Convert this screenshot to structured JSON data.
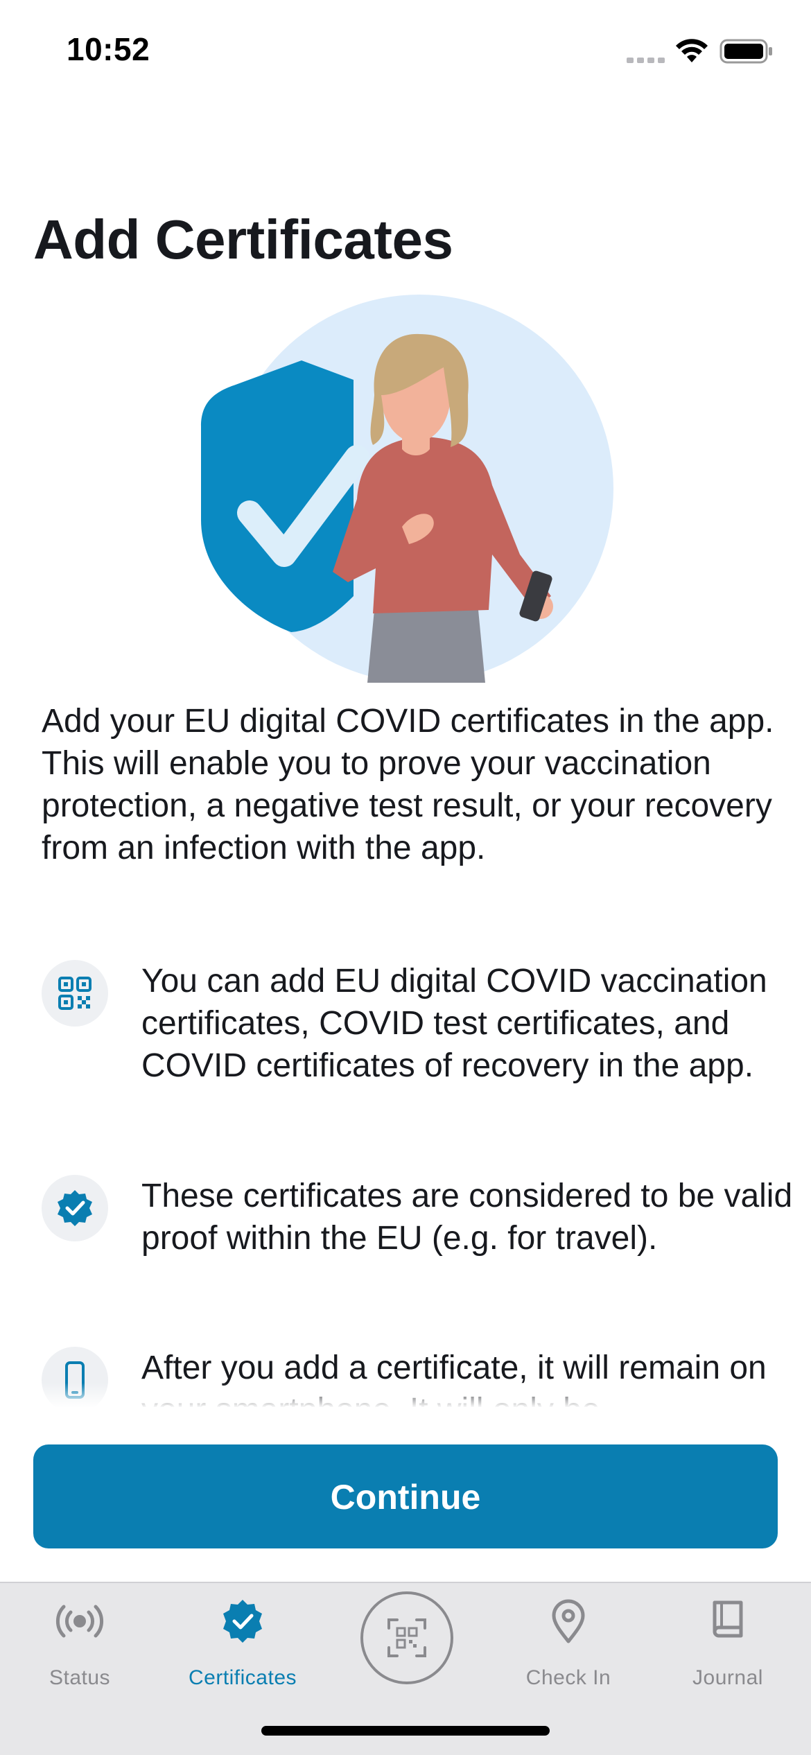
{
  "status_bar": {
    "time": "10:52"
  },
  "page": {
    "title": "Add Certificates",
    "intro": "Add your EU digital COVID certificates in the app. This will enable you to prove your vaccination protection, a negative test result, or your recovery from an infection with the app."
  },
  "features": [
    {
      "icon": "qr-code-icon",
      "text": "You can add EU digital COVID vaccination certificates, COVID test certificates, and COVID certificates of recovery in the app."
    },
    {
      "icon": "verified-badge-icon",
      "text": "These certificates are considered to be valid proof within the EU (e.g. for travel)."
    },
    {
      "icon": "smartphone-icon",
      "text": "After you add a certificate, it will remain on your smartphone. It will only be"
    }
  ],
  "continue_button": {
    "label": "Continue"
  },
  "tab_bar": {
    "tabs": [
      {
        "label": "Status",
        "icon": "broadcast-icon",
        "active": false
      },
      {
        "label": "Certificates",
        "icon": "verified-badge-icon",
        "active": true
      },
      {
        "label": "",
        "icon": "qr-scan-icon",
        "active": false
      },
      {
        "label": "Check In",
        "icon": "location-pin-icon",
        "active": false
      },
      {
        "label": "Journal",
        "icon": "book-icon",
        "active": false
      }
    ]
  },
  "colors": {
    "accent": "#0a7eb1",
    "text": "#17191e",
    "tab_inactive": "#8a8a8e",
    "illustration_circle": "#dcecfb",
    "shirt": "#c0645e",
    "hair": "#c8a97a"
  }
}
